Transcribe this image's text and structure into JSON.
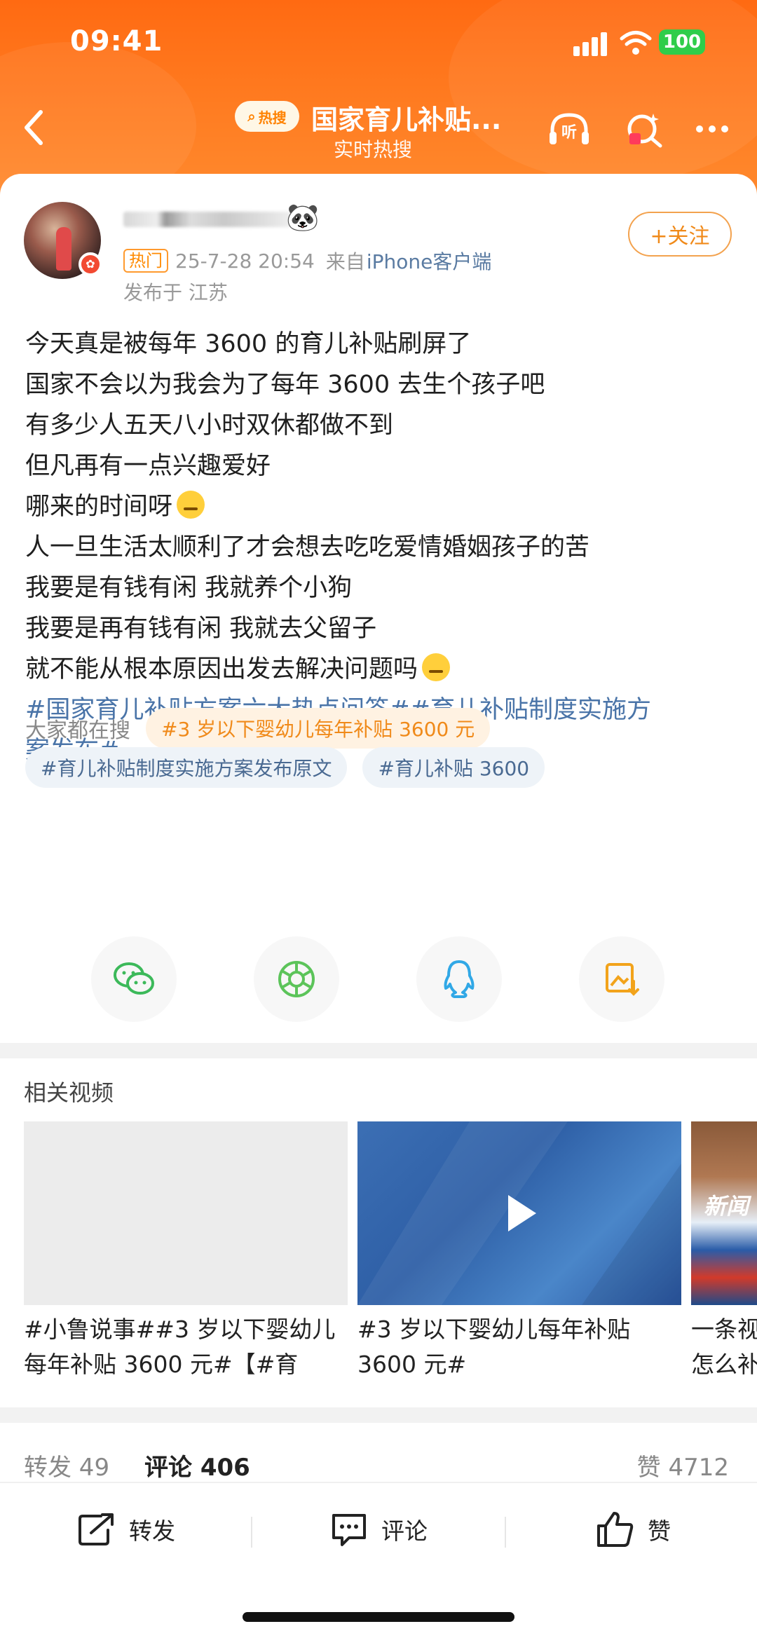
{
  "status_bar": {
    "time": "09:41",
    "battery": "100"
  },
  "nav": {
    "hot_badge": "热搜",
    "title": "国家育儿补贴...",
    "subtitle": "实时热搜",
    "listen_label": "听"
  },
  "post": {
    "hot_tag": "热门",
    "datetime": "25-7-28 20:54",
    "source_prefix": "来自",
    "source": "iPhone客户端",
    "location": "发布于 江苏",
    "follow_label": "+关注",
    "lines": [
      "今天真是被每年 3600 的育儿补贴刷屏了",
      "国家不会以为我会为了每年 3600 去生个孩子吧",
      "有多少人五天八小时双休都做不到",
      "但凡再有一点兴趣爱好",
      "哪来的时间呀",
      "人一旦生活太顺利了才会想去吃吃爱情婚姻孩子的苦",
      "我要是有钱有闲 我就养个小狗",
      "我要是再有钱有闲 我就去父留子",
      "就不能从根本原因出发去解决问题吗"
    ],
    "topics_line1": "#国家育儿补贴方案六大热点问答##育儿补贴制度实施方",
    "topics_line2": "案发布#",
    "search_label": "大家都在搜",
    "search_pills": [
      "#3 岁以下婴幼儿每年补贴 3600 元",
      "#育儿补贴制度实施方案发布原文",
      "#育儿补贴 3600"
    ]
  },
  "share": [
    "wechat-icon",
    "moments-icon",
    "qq-icon",
    "save-image-icon"
  ],
  "related": {
    "title": "相关视频",
    "videos": [
      {
        "caption1": "#小鲁说事##3 岁以下婴幼儿",
        "caption2": "每年补贴 3600 元#【#育"
      },
      {
        "caption1": "#3 岁以下婴幼儿每年补贴",
        "caption2": "3600 元#"
      },
      {
        "caption1": "一条视",
        "caption2": "怎么补",
        "thumb_text": "新闻"
      }
    ]
  },
  "stats": {
    "repost": "转发 49",
    "comments": "评论 406",
    "likes": "赞 4712"
  },
  "bottom_bar": {
    "repost": "转发",
    "comment": "评论",
    "like": "赞"
  },
  "colors": {
    "header": "#ff6a12",
    "accent": "#f08a1a",
    "topic": "#4a74a8"
  }
}
